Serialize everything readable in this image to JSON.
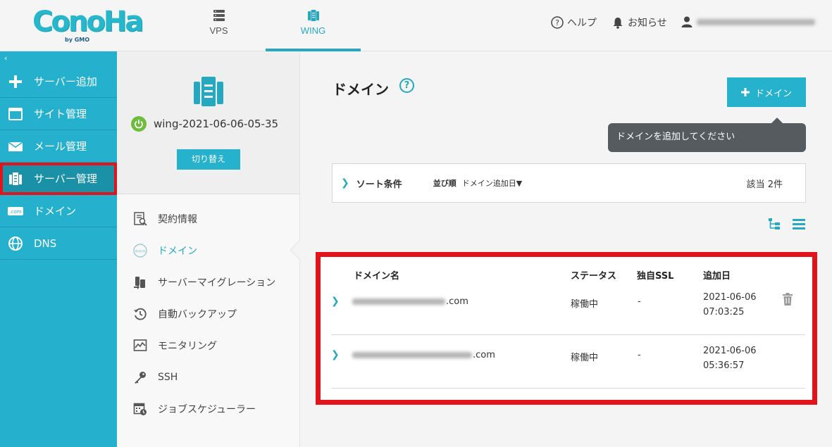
{
  "header": {
    "logo_text": "ConoHa",
    "logo_sub": "by GMO",
    "tabs": [
      {
        "label": "VPS",
        "icon": "server-rack-icon"
      },
      {
        "label": "WING",
        "icon": "wing-server-icon"
      }
    ],
    "help_label": "ヘルプ",
    "notice_label": "お知らせ",
    "user_email_redacted": true
  },
  "sidebar": {
    "collapse_glyph": "‹",
    "items": [
      {
        "label": "サーバー追加",
        "icon": "plus-icon"
      },
      {
        "label": "サイト管理",
        "icon": "browser-window-icon"
      },
      {
        "label": "メール管理",
        "icon": "mail-icon"
      },
      {
        "label": "サーバー管理",
        "icon": "server-icon",
        "active": true
      },
      {
        "label": "ドメイン",
        "icon": "domain-com-icon"
      },
      {
        "label": "DNS",
        "icon": "globe-icon"
      }
    ]
  },
  "server_panel": {
    "server_name": "wing-2021-06-06-05-35",
    "switch_label": "切り替え",
    "menu": [
      {
        "label": "契約情報",
        "icon": "contract-search-icon"
      },
      {
        "label": "ドメイン",
        "icon": "www-globe-icon",
        "active": true
      },
      {
        "label": "サーバーマイグレーション",
        "icon": "migration-icon"
      },
      {
        "label": "自動バックアップ",
        "icon": "backup-clock-icon"
      },
      {
        "label": "モニタリング",
        "icon": "monitoring-chart-icon"
      },
      {
        "label": "SSH",
        "icon": "key-icon"
      },
      {
        "label": "ジョブスケジューラー",
        "icon": "calendar-clock-icon"
      }
    ]
  },
  "main": {
    "title": "ドメイン",
    "help_glyph": "?",
    "add_button_label": "ドメイン",
    "tooltip": "ドメインを追加してください",
    "sort": {
      "label": "ソート条件",
      "order_label": "並び順",
      "order_value": "ドメイン追加日▼",
      "count": "該当 2件"
    },
    "table": {
      "headers": [
        "ドメイン名",
        "ステータス",
        "独自SSL",
        "追加日"
      ],
      "rows": [
        {
          "domain_suffix": ".com",
          "status": "稼働中",
          "ssl": "-",
          "date": "2021-06-06",
          "time": "07:03:25"
        },
        {
          "domain_suffix": ".com",
          "status": "稼働中",
          "ssl": "-",
          "date": "2021-06-06",
          "time": "05:36:57"
        }
      ]
    }
  },
  "colors": {
    "accent": "#26b1cd",
    "highlight": "#e3131b",
    "tooltip_bg": "#555b5e",
    "power_green": "#6cbd3b"
  }
}
